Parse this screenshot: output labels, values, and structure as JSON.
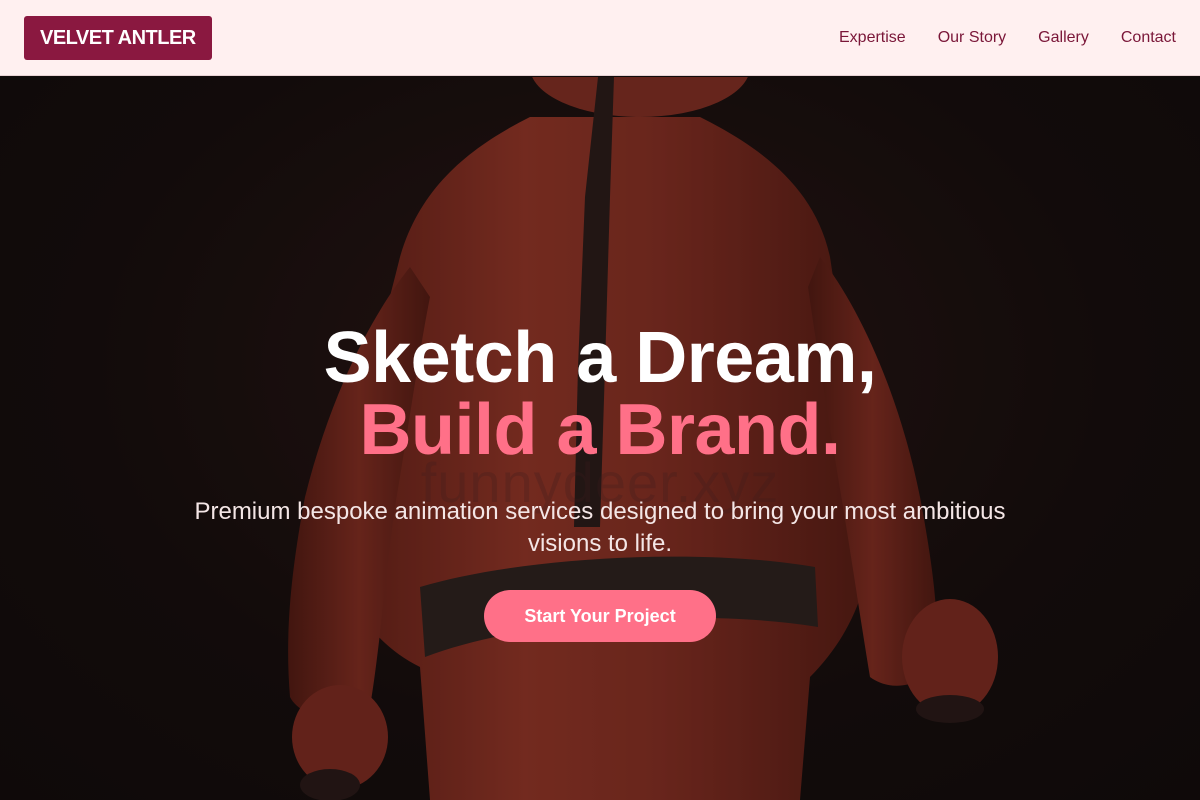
{
  "nav": {
    "logo": "VELVET ANTLER",
    "links": [
      {
        "label": "Expertise"
      },
      {
        "label": "Our Story"
      },
      {
        "label": "Gallery"
      },
      {
        "label": "Contact"
      }
    ]
  },
  "hero": {
    "headline_line1": "Sketch a Dream,",
    "headline_line2": "Build a Brand.",
    "watermark": "funnydeer.xyz",
    "tagline": "Premium bespoke animation services designed to bring your most ambitious visions to life.",
    "cta_label": "Start Your Project"
  },
  "colors": {
    "nav_background": "#fff0f0",
    "logo_background": "#8a1840",
    "nav_link": "#7a1638",
    "accent": "#ff7088",
    "hero_background": "#120c0c"
  }
}
